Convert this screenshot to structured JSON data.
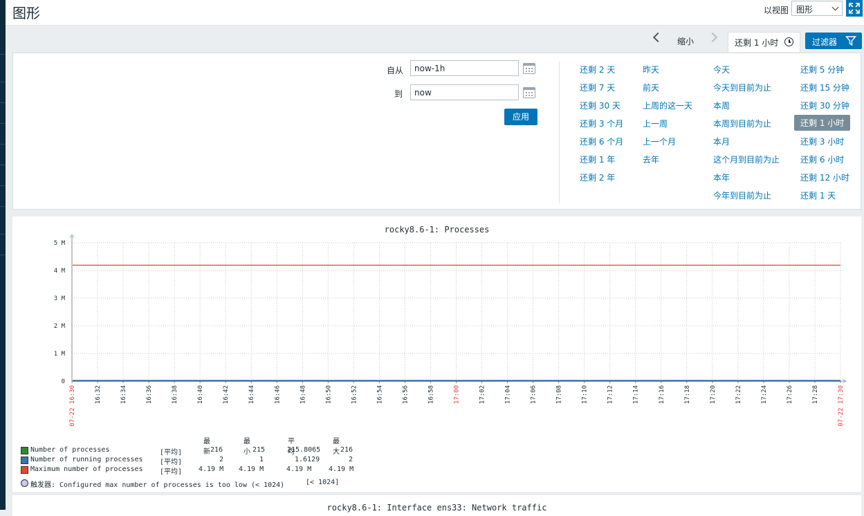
{
  "header": {
    "title": "图形",
    "view_label": "以视图",
    "view_value": "图形"
  },
  "tabs": {
    "zoom_out": "缩小",
    "time_tab": "还剩 1 小时",
    "filter": "过滤器"
  },
  "filter": {
    "from_label": "自从",
    "from_value": "now-1h",
    "to_label": "到",
    "to_value": "now",
    "apply": "应用",
    "quick_ranges": [
      [
        "还剩 2 天",
        "还剩 7 天",
        "还剩 30 天",
        "还剩 3 个月",
        "还剩 6 个月",
        "还剩 1 年",
        "还剩 2 年"
      ],
      [
        "昨天",
        "前天",
        "上周的这一天",
        "上一周",
        "上一个月",
        "去年"
      ],
      [
        "今天",
        "今天到目前为止",
        "本周",
        "本周到目前为止",
        "本月",
        "这个月到目前为止",
        "本年",
        "今年到目前为止"
      ],
      [
        "还剩 5 分钟",
        "还剩 15 分钟",
        "还剩 30 分钟",
        "还剩 1 小时",
        "还剩 3 小时",
        "还剩 6 小时",
        "还剩 12 小时",
        "还剩 1 天"
      ]
    ],
    "selected_range": "还剩 1 小时"
  },
  "chart_data": {
    "type": "line",
    "title": "rocky8.6-1: Processes",
    "y_ticks": [
      "0",
      "1 M",
      "2 M",
      "3 M",
      "4 M",
      "5 M"
    ],
    "ylim": [
      0,
      5000000
    ],
    "x_start_label": "07-22 16:30",
    "x_end_label": "07-22 17:30",
    "x_ticks": [
      "16:32",
      "16:34",
      "16:36",
      "16:38",
      "16:40",
      "16:42",
      "16:44",
      "16:46",
      "16:48",
      "16:50",
      "16:52",
      "16:54",
      "16:56",
      "16:58",
      "17:00",
      "17:02",
      "17:04",
      "17:06",
      "17:08",
      "17:10",
      "17:12",
      "17:14",
      "17:16",
      "17:18",
      "17:20",
      "17:22",
      "17:24",
      "17:26",
      "17:28"
    ],
    "highlight_tick": "17:00",
    "grid": true,
    "series": [
      {
        "name": "Number of processes",
        "color": "#2e8a2e",
        "value": 216
      },
      {
        "name": "Number of running processes",
        "color": "#3577a8",
        "value": 2
      },
      {
        "name": "Maximum number of processes",
        "color": "#e8452c",
        "value": 4190000
      }
    ],
    "legend_headers": [
      "最新",
      "最小",
      "平均",
      "最大"
    ],
    "legend_rows": [
      {
        "name": "Number of processes",
        "func": "[平均]",
        "last": "216",
        "min": "215",
        "avg": "215.8065",
        "max": "216"
      },
      {
        "name": "Number of running processes",
        "func": "[平均]",
        "last": "2",
        "min": "1",
        "avg": "1.6129",
        "max": "2"
      },
      {
        "name": "Maximum number of processes",
        "func": "[平均]",
        "last": "4.19 M",
        "min": "4.19 M",
        "avg": "4.19 M",
        "max": "4.19 M"
      }
    ],
    "trigger": {
      "text": "触发器: Configured max number of processes is too low (< 1024)",
      "threshold": "[< 1024]"
    }
  },
  "graph2": {
    "title": "rocky8.6-1: Interface ens33: Network traffic"
  }
}
